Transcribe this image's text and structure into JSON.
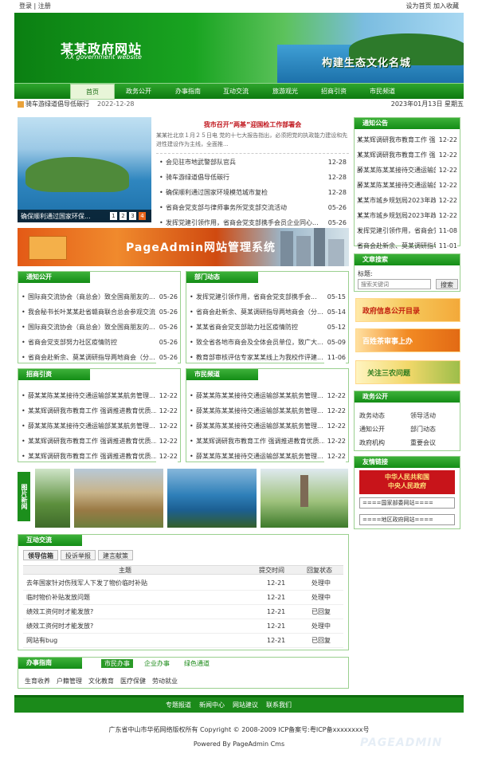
{
  "topbar": {
    "login": "登录",
    "register": "注册",
    "sep": "|",
    "set_home": "设为首页",
    "favorite": "加入收藏"
  },
  "banner": {
    "title": "某某政府网站",
    "subtitle": "XX government website",
    "slogan": "构建生态文化名城"
  },
  "nav": [
    "首页",
    "政务公开",
    "办事指南",
    "互动交流",
    "旅游观光",
    "招商引资",
    "市民频道"
  ],
  "notice": {
    "text": "骑车游绿道倡导低碳行",
    "date": "2022-12-28",
    "today": "2023年01月13日 星期五"
  },
  "headline": {
    "title": "我市召开“两基”迎国检工作部署会",
    "summary": "某某社北京１月２５日电 党的十七大报告指出，必须把党的执政能力建设和先进性建设作为主线，全面推...",
    "caption": "确保顺利通过国家环保...",
    "pages": [
      "1",
      "2",
      "3",
      "4"
    ]
  },
  "top_news": [
    {
      "t": "会见驻市地武警部队官兵",
      "d": "12-28"
    },
    {
      "t": "骑车游绿道倡导低碳行",
      "d": "12-28"
    },
    {
      "t": "确保顺利通过国家环境模范城市复检",
      "d": "12-28"
    },
    {
      "t": "省商会党支部与律师事务所党支部交流活动",
      "d": "05-26"
    },
    {
      "t": "发挥党建引领作用，省商会党支部携手会员企业同心...",
      "d": "05-26"
    }
  ],
  "ad_banner": "PageAdmin网站管理系统",
  "tongzhi": {
    "title": "通知公开",
    "items": [
      {
        "t": "国际商交流协会（商总会）致全国商朋友的...",
        "d": "05-26"
      },
      {
        "t": "我会秘书长叶某某赴省赣商联合总会参观交流",
        "d": "05-26"
      },
      {
        "t": "国际商交流协会（商总会）致全国商朋友的...",
        "d": "05-26"
      },
      {
        "t": "省商会党支部努力社区疫情防控",
        "d": "05-26"
      },
      {
        "t": "省商会赴新余、莫某调研指导两地商会（分...",
        "d": "05-26"
      }
    ]
  },
  "bumen": {
    "title": "部门动态",
    "items": [
      {
        "t": "发挥党建引领作用，省商会党支部携手会...",
        "d": "05-15"
      },
      {
        "t": "省商会赴新余、莫某调研指导两地商会（分...",
        "d": "05-14"
      },
      {
        "t": "某某省商会党支部助力社区疫情防控",
        "d": "05-12"
      },
      {
        "t": "致全省各地市商会及全体会员单位，致广大...",
        "d": "05-09"
      },
      {
        "t": "教育部审核评估专家某某线上为我校作评建...",
        "d": "11-06"
      }
    ]
  },
  "zhaoshang": {
    "title": "招商引资",
    "items": [
      {
        "t": "薛某某陈某某接待交通运输部某某航务管理...",
        "d": "12-22"
      },
      {
        "t": "某某辉调研我市教育工作 强调推进教育优质...",
        "d": "12-22"
      },
      {
        "t": "薛某某陈某某接待交通运输部某某航务管理...",
        "d": "12-22"
      },
      {
        "t": "某某辉调研我市教育工作 强调推进教育优质...",
        "d": "12-22"
      },
      {
        "t": "某某辉调研我市教育工作 强调推进教育优质...",
        "d": "12-22"
      }
    ]
  },
  "shimin": {
    "title": "市民频道",
    "items": [
      {
        "t": "薛某某陈某某接待交通运输部某某航务管理...",
        "d": "12-22"
      },
      {
        "t": "薛某某陈某某接待交通运输部某某航务管理...",
        "d": "12-22"
      },
      {
        "t": "薛某某陈某某接待交通运输部某某航务管理...",
        "d": "12-22"
      },
      {
        "t": "某某辉调研我市教育工作 强调推进教育优质...",
        "d": "12-22"
      },
      {
        "t": "薛某某陈某某接待交通运输部某某航务管理...",
        "d": "12-22"
      }
    ]
  },
  "photo_label": "图片新闻",
  "hudong": {
    "title": "互动交流",
    "tabs": [
      "领导信箱",
      "投诉举报",
      "建言献策"
    ],
    "headers": [
      "主题",
      "提交时间",
      "回复状态"
    ],
    "rows": [
      [
        "去年国家针对伤残军人下发了物价临时补贴",
        "12-21",
        "处理中"
      ],
      [
        "临时物价补贴发放问题",
        "12-21",
        "处理中"
      ],
      [
        "绩效工资何时才能发放?",
        "12-21",
        "已回复"
      ],
      [
        "绩效工资何时才能发放?",
        "12-21",
        "处理中"
      ],
      [
        "网站有bug",
        "12-21",
        "已回复"
      ]
    ]
  },
  "banshi": {
    "title": "办事指南",
    "tabs": [
      "市民办事",
      "企业办事",
      "绿色通道"
    ],
    "items": [
      "生育收养",
      "户籍管理",
      "文化教育",
      "医疗保健",
      "劳动就业"
    ]
  },
  "right_notice": {
    "title": "通知公告",
    "items": [
      {
        "t": "某某辉调研我市教育工作 强...",
        "d": "12-22"
      },
      {
        "t": "某某辉调研我市教育工作 强...",
        "d": "12-22"
      },
      {
        "t": "薛某某陈某某接待交通运输部...",
        "d": "12-22"
      },
      {
        "t": "薛某某陈某某接待交通运输部...",
        "d": "12-22"
      },
      {
        "t": "某某市城乡规划局2023年政府...",
        "d": "12-22"
      },
      {
        "t": "某某市城乡规划局2023年政府...",
        "d": "12-22"
      },
      {
        "t": "发挥党建引领作用，省商会党...",
        "d": "11-08"
      },
      {
        "t": "省商会赴新余、莫某调研指导...",
        "d": "11-01"
      }
    ]
  },
  "search": {
    "title": "文章搜索",
    "label": "标题:",
    "placeholder": "搜索关键词",
    "button": "搜索"
  },
  "promos": [
    "政府信息公开目录",
    "百姓茶审事上办",
    "关注三农问题"
  ],
  "zhengwu": {
    "title": "政务公开",
    "items": [
      "政务动态",
      "领导活动",
      "通知公开",
      "部门动态",
      "政府机构",
      "重要会议"
    ]
  },
  "links": {
    "title": "友情链接",
    "gov": "中华人民共和国\n中央人民政府",
    "sel1": "====国家部委网站====",
    "sel2": "====地区政府网站===="
  },
  "footer": {
    "links": [
      "专题报道",
      "新闻中心",
      "网站建议",
      "联系我们"
    ],
    "copyright": "广东省中山市华拓网络版权所有 Copyright © 2008-2009  ICP备案号:粤ICP备xxxxxxxx号",
    "powered": "Powered By PageAdmin Cms",
    "watermark": "PAGEADMIN"
  },
  "colors": {
    "green": "#138d16",
    "light_green": "#9ad08f"
  }
}
